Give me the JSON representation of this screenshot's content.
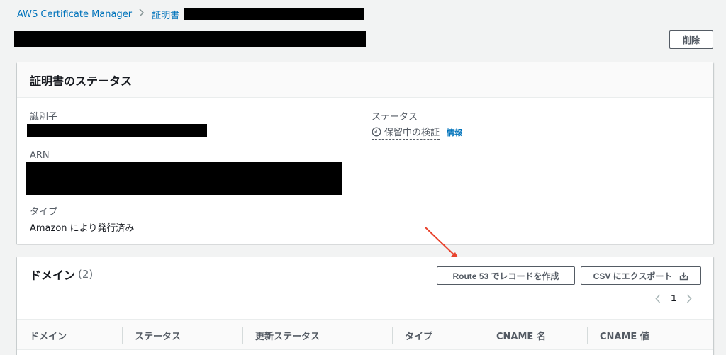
{
  "breadcrumb": {
    "items": [
      "AWS Certificate Manager",
      "証明書"
    ],
    "separator": ">"
  },
  "header": {
    "delete_label": "削除"
  },
  "status_panel": {
    "title": "証明書のステータス",
    "identifier_label": "識別子",
    "arn_label": "ARN",
    "type_label": "タイプ",
    "type_value": "Amazon により発行済み",
    "status_label": "ステータス",
    "status_value": "保留中の検証",
    "info_link": "情報"
  },
  "domains_panel": {
    "title": "ドメイン",
    "count": "(2)",
    "route53_button": "Route 53 でレコードを作成",
    "csv_button": "CSV にエクスポート",
    "page_number": "1",
    "columns": [
      "ドメイン",
      "ステータス",
      "更新ステータス",
      "タイプ",
      "CNAME 名",
      "CNAME 値"
    ]
  },
  "colors": {
    "link": "#0073bb",
    "annotation_arrow": "#e8432d"
  }
}
